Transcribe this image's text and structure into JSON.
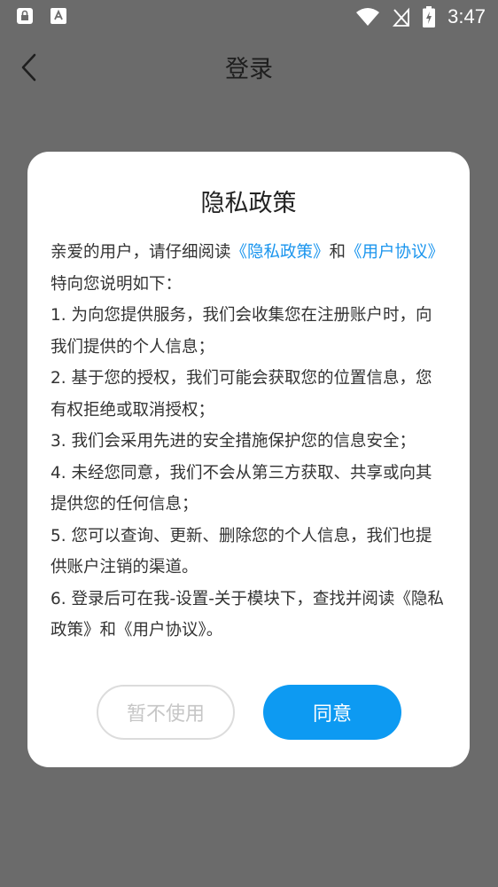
{
  "status_bar": {
    "time": "3:47",
    "icons": [
      "lock-notification-icon",
      "app-notification-icon",
      "wifi-icon",
      "no-signal-icon",
      "battery-charging-icon"
    ]
  },
  "app_bar": {
    "title": "登录",
    "back_icon": "chevron-left-icon"
  },
  "dialog": {
    "title": "隐私政策",
    "intro": {
      "prefix": "亲爱的用户，请仔细阅读",
      "privacy_link": "《隐私政策》",
      "and": "和",
      "agreement_link": "《用户协议》",
      "suffix": "特向您说明如下："
    },
    "items": [
      "1. 为向您提供服务，我们会收集您在注册账户时，向我们提供的个人信息；",
      "2. 基于您的授权，我们可能会获取您的位置信息，您有权拒绝或取消授权；",
      "3. 我们会采用先进的安全措施保护您的信息安全；",
      "4. 未经您同意，我们不会从第三方获取、共享或向其提供您的任何信息；",
      "5. 您可以查询、更新、删除您的个人信息，我们也提供账户注销的渠道。",
      "6. 登录后可在我-设置-关于模块下，查找并阅读《隐私政策》和《用户协议》。"
    ],
    "decline_label": "暂不使用",
    "agree_label": "同意"
  },
  "colors": {
    "overlay": "#6b6b6b",
    "accent": "#0d9af2",
    "link": "#1a95ee",
    "decline_text": "#c6c6c6"
  }
}
